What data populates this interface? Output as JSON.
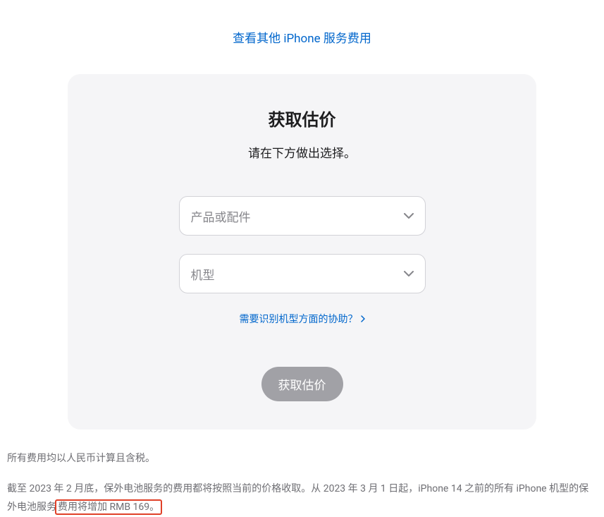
{
  "topLink": "查看其他 iPhone 服务费用",
  "card": {
    "title": "获取估价",
    "subtitle": "请在下方做出选择。",
    "select1": {
      "placeholder": "产品或配件"
    },
    "select2": {
      "placeholder": "机型"
    },
    "helpLink": "需要识别机型方面的协助？",
    "submitLabel": "获取估价"
  },
  "footer": {
    "line1": "所有费用均以人民币计算且含税。",
    "line2a": "截至 2023 年 2 月底，保外电池服务的费用都将按照当前的价格收取。从 2023 年 3 月 1 日起，iPhone 14 之前的所有 iPhone 机型的保外电池服务",
    "line2b": "费用将增加 RMB 169。"
  }
}
